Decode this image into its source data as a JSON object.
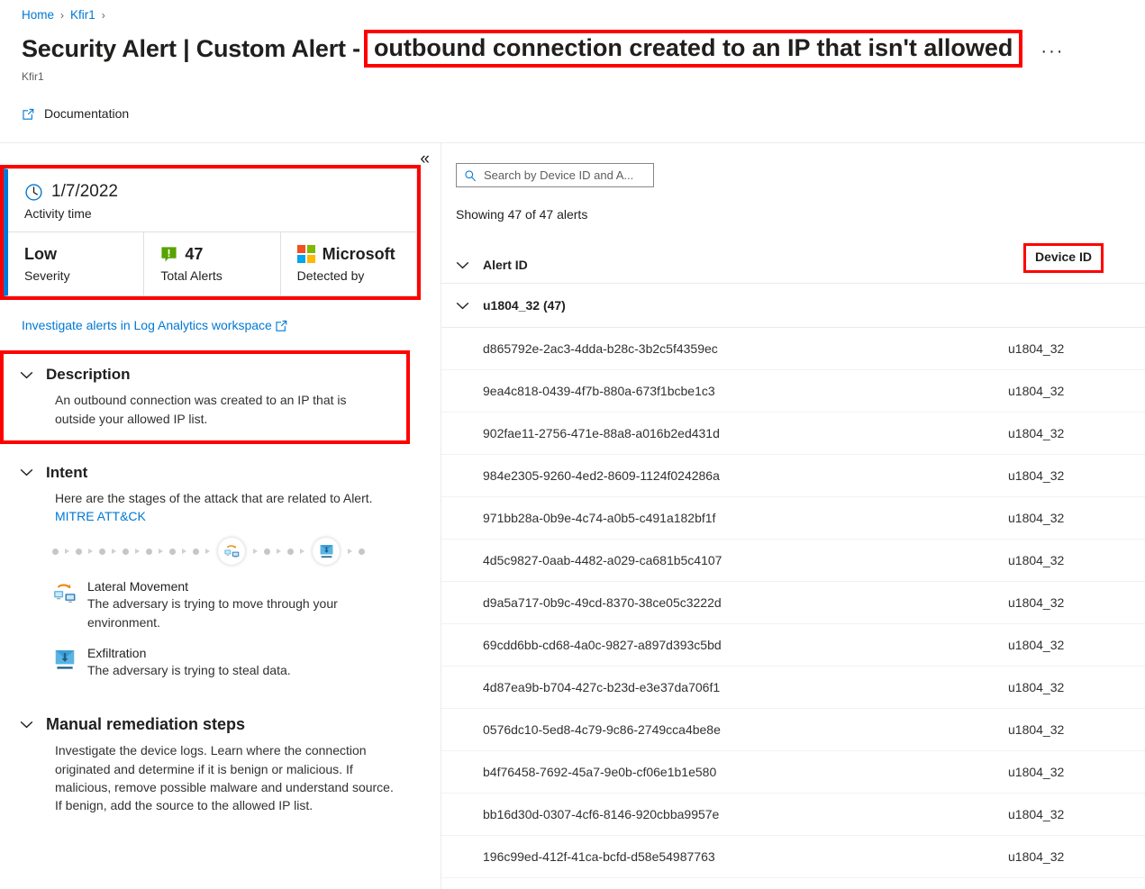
{
  "breadcrumb": {
    "items": [
      "Home",
      "Kfir1"
    ],
    "separator": "›"
  },
  "header": {
    "title_prefix": "Security Alert | Custom Alert -",
    "title_highlight": "outbound connection created to an IP that isn't allowed",
    "subtitle": "Kfir1",
    "more_label": "···",
    "documentation_label": "Documentation",
    "documentation_icon": "external-link-icon"
  },
  "left_pane": {
    "collapse_label": "«",
    "summary": {
      "activity_time_value": "1/7/2022",
      "activity_time_label": "Activity time",
      "activity_time_icon": "clock-icon",
      "cells": [
        {
          "value": "Low",
          "label": "Severity",
          "icon": null
        },
        {
          "value": "47",
          "label": "Total Alerts",
          "icon": "alert-bubble-icon"
        },
        {
          "value": "Microsoft",
          "label": "Detected by",
          "icon": "microsoft-logo-icon"
        }
      ]
    },
    "log_analytics_link": "Investigate alerts in Log Analytics workspace",
    "description": {
      "title": "Description",
      "body": "An outbound connection was created to an IP that is outside your allowed IP list."
    },
    "intent": {
      "title": "Intent",
      "body_prefix": "Here are the stages of the attack that are related to Alert.",
      "link": "MITRE ATT&CK",
      "chain": {
        "leading_dots": 7,
        "middle_dots": 2,
        "trailing_dots": 1,
        "nodes": [
          "lateral-movement-icon",
          "exfiltration-icon"
        ]
      },
      "stages": [
        {
          "name": "Lateral Movement",
          "description": "The adversary is trying to move through your environment.",
          "icon": "lateral-movement-icon"
        },
        {
          "name": "Exfiltration",
          "description": "The adversary is trying to steal data.",
          "icon": "exfiltration-icon"
        }
      ]
    },
    "manual_remediation": {
      "title": "Manual remediation steps",
      "body": "Investigate the device logs. Learn where the connection originated and determine if it is benign or malicious. If malicious, remove possible malware and understand source. If benign, add the source to the allowed IP list."
    }
  },
  "right_pane": {
    "search": {
      "placeholder": "Search by Device ID and A...",
      "value": "",
      "icon": "search-icon"
    },
    "showing_text": "Showing 47 of 47 alerts",
    "columns": {
      "alert_id": "Alert ID",
      "device_id": "Device ID"
    },
    "group": {
      "label": "u1804_32 (47)",
      "expanded": true
    },
    "rows": [
      {
        "alert_id": "d865792e-2ac3-4dda-b28c-3b2c5f4359ec",
        "device_id": "u1804_32"
      },
      {
        "alert_id": "9ea4c818-0439-4f7b-880a-673f1bcbe1c3",
        "device_id": "u1804_32"
      },
      {
        "alert_id": "902fae11-2756-471e-88a8-a016b2ed431d",
        "device_id": "u1804_32"
      },
      {
        "alert_id": "984e2305-9260-4ed2-8609-1124f024286a",
        "device_id": "u1804_32"
      },
      {
        "alert_id": "971bb28a-0b9e-4c74-a0b5-c491a182bf1f",
        "device_id": "u1804_32"
      },
      {
        "alert_id": "4d5c9827-0aab-4482-a029-ca681b5c4107",
        "device_id": "u1804_32"
      },
      {
        "alert_id": "d9a5a717-0b9c-49cd-8370-38ce05c3222d",
        "device_id": "u1804_32"
      },
      {
        "alert_id": "69cdd6bb-cd68-4a0c-9827-a897d393c5bd",
        "device_id": "u1804_32"
      },
      {
        "alert_id": "4d87ea9b-b704-427c-b23d-e3e37da706f1",
        "device_id": "u1804_32"
      },
      {
        "alert_id": "0576dc10-5ed8-4c79-9c86-2749cca4be8e",
        "device_id": "u1804_32"
      },
      {
        "alert_id": "b4f76458-7692-45a7-9e0b-cf06e1b1e580",
        "device_id": "u1804_32"
      },
      {
        "alert_id": "bb16d30d-0307-4cf6-8146-920cbba9957e",
        "device_id": "u1804_32"
      },
      {
        "alert_id": "196c99ed-412f-41ca-bcfd-d58e54987763",
        "device_id": "u1804_32"
      }
    ]
  },
  "colors": {
    "accent_blue": "#0078d4",
    "highlight_red": "#ff0000",
    "severity_green": "#57a300",
    "ms_red": "#f25022",
    "ms_green": "#7fba00",
    "ms_blue": "#00a4ef",
    "ms_yellow": "#ffb900",
    "border_grey": "#edebe9"
  }
}
